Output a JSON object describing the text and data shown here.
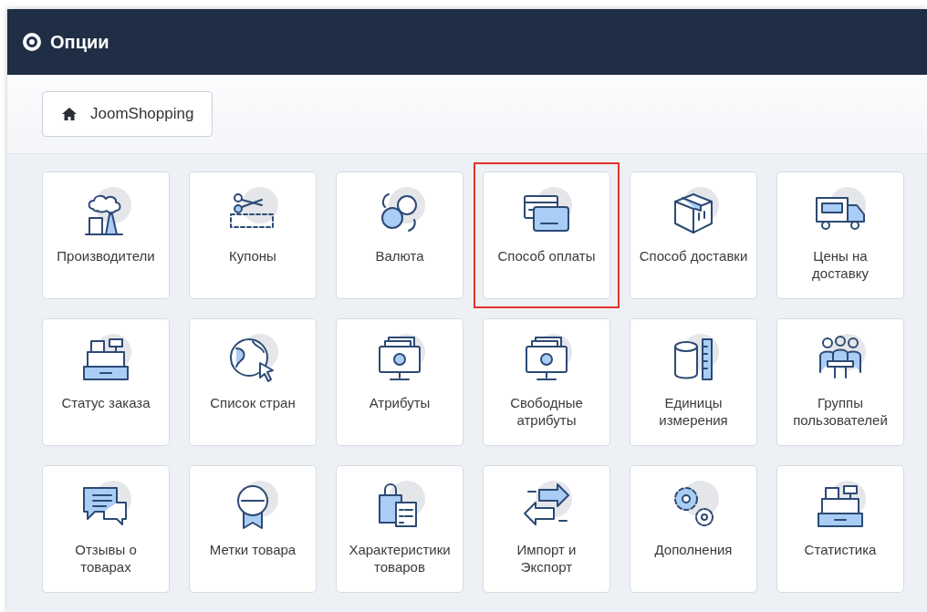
{
  "header": {
    "title": "Опции"
  },
  "toolbar": {
    "button": {
      "label": "JoomShopping"
    }
  },
  "tiles": [
    {
      "label": "Производители",
      "kind": "factory",
      "highlighted": false
    },
    {
      "label": "Купоны",
      "kind": "coupon",
      "highlighted": false
    },
    {
      "label": "Валюта",
      "kind": "currency",
      "highlighted": false
    },
    {
      "label": "Способ оплаты",
      "kind": "cards",
      "highlighted": true
    },
    {
      "label": "Способ доставки",
      "kind": "box",
      "highlighted": false
    },
    {
      "label": "Цены на доставку",
      "kind": "truck",
      "highlighted": false
    },
    {
      "label": "Статус заказа",
      "kind": "register",
      "highlighted": false
    },
    {
      "label": "Список стран",
      "kind": "globe",
      "highlighted": false
    },
    {
      "label": "Атрибуты",
      "kind": "monitor",
      "highlighted": false
    },
    {
      "label": "Свободные атрибуты",
      "kind": "monitor",
      "highlighted": false
    },
    {
      "label": "Единицы измерения",
      "kind": "cylinder",
      "highlighted": false
    },
    {
      "label": "Группы пользователей",
      "kind": "people",
      "highlighted": false
    },
    {
      "label": "Отзывы о товарах",
      "kind": "chat",
      "highlighted": false
    },
    {
      "label": "Метки товара",
      "kind": "ribbon",
      "highlighted": false
    },
    {
      "label": "Характеристики товаров",
      "kind": "bag",
      "highlighted": false
    },
    {
      "label": "Импорт и Экспорт",
      "kind": "arrows",
      "highlighted": false
    },
    {
      "label": "Дополнения",
      "kind": "gears",
      "highlighted": false
    },
    {
      "label": "Статистика",
      "kind": "register",
      "highlighted": false
    }
  ]
}
